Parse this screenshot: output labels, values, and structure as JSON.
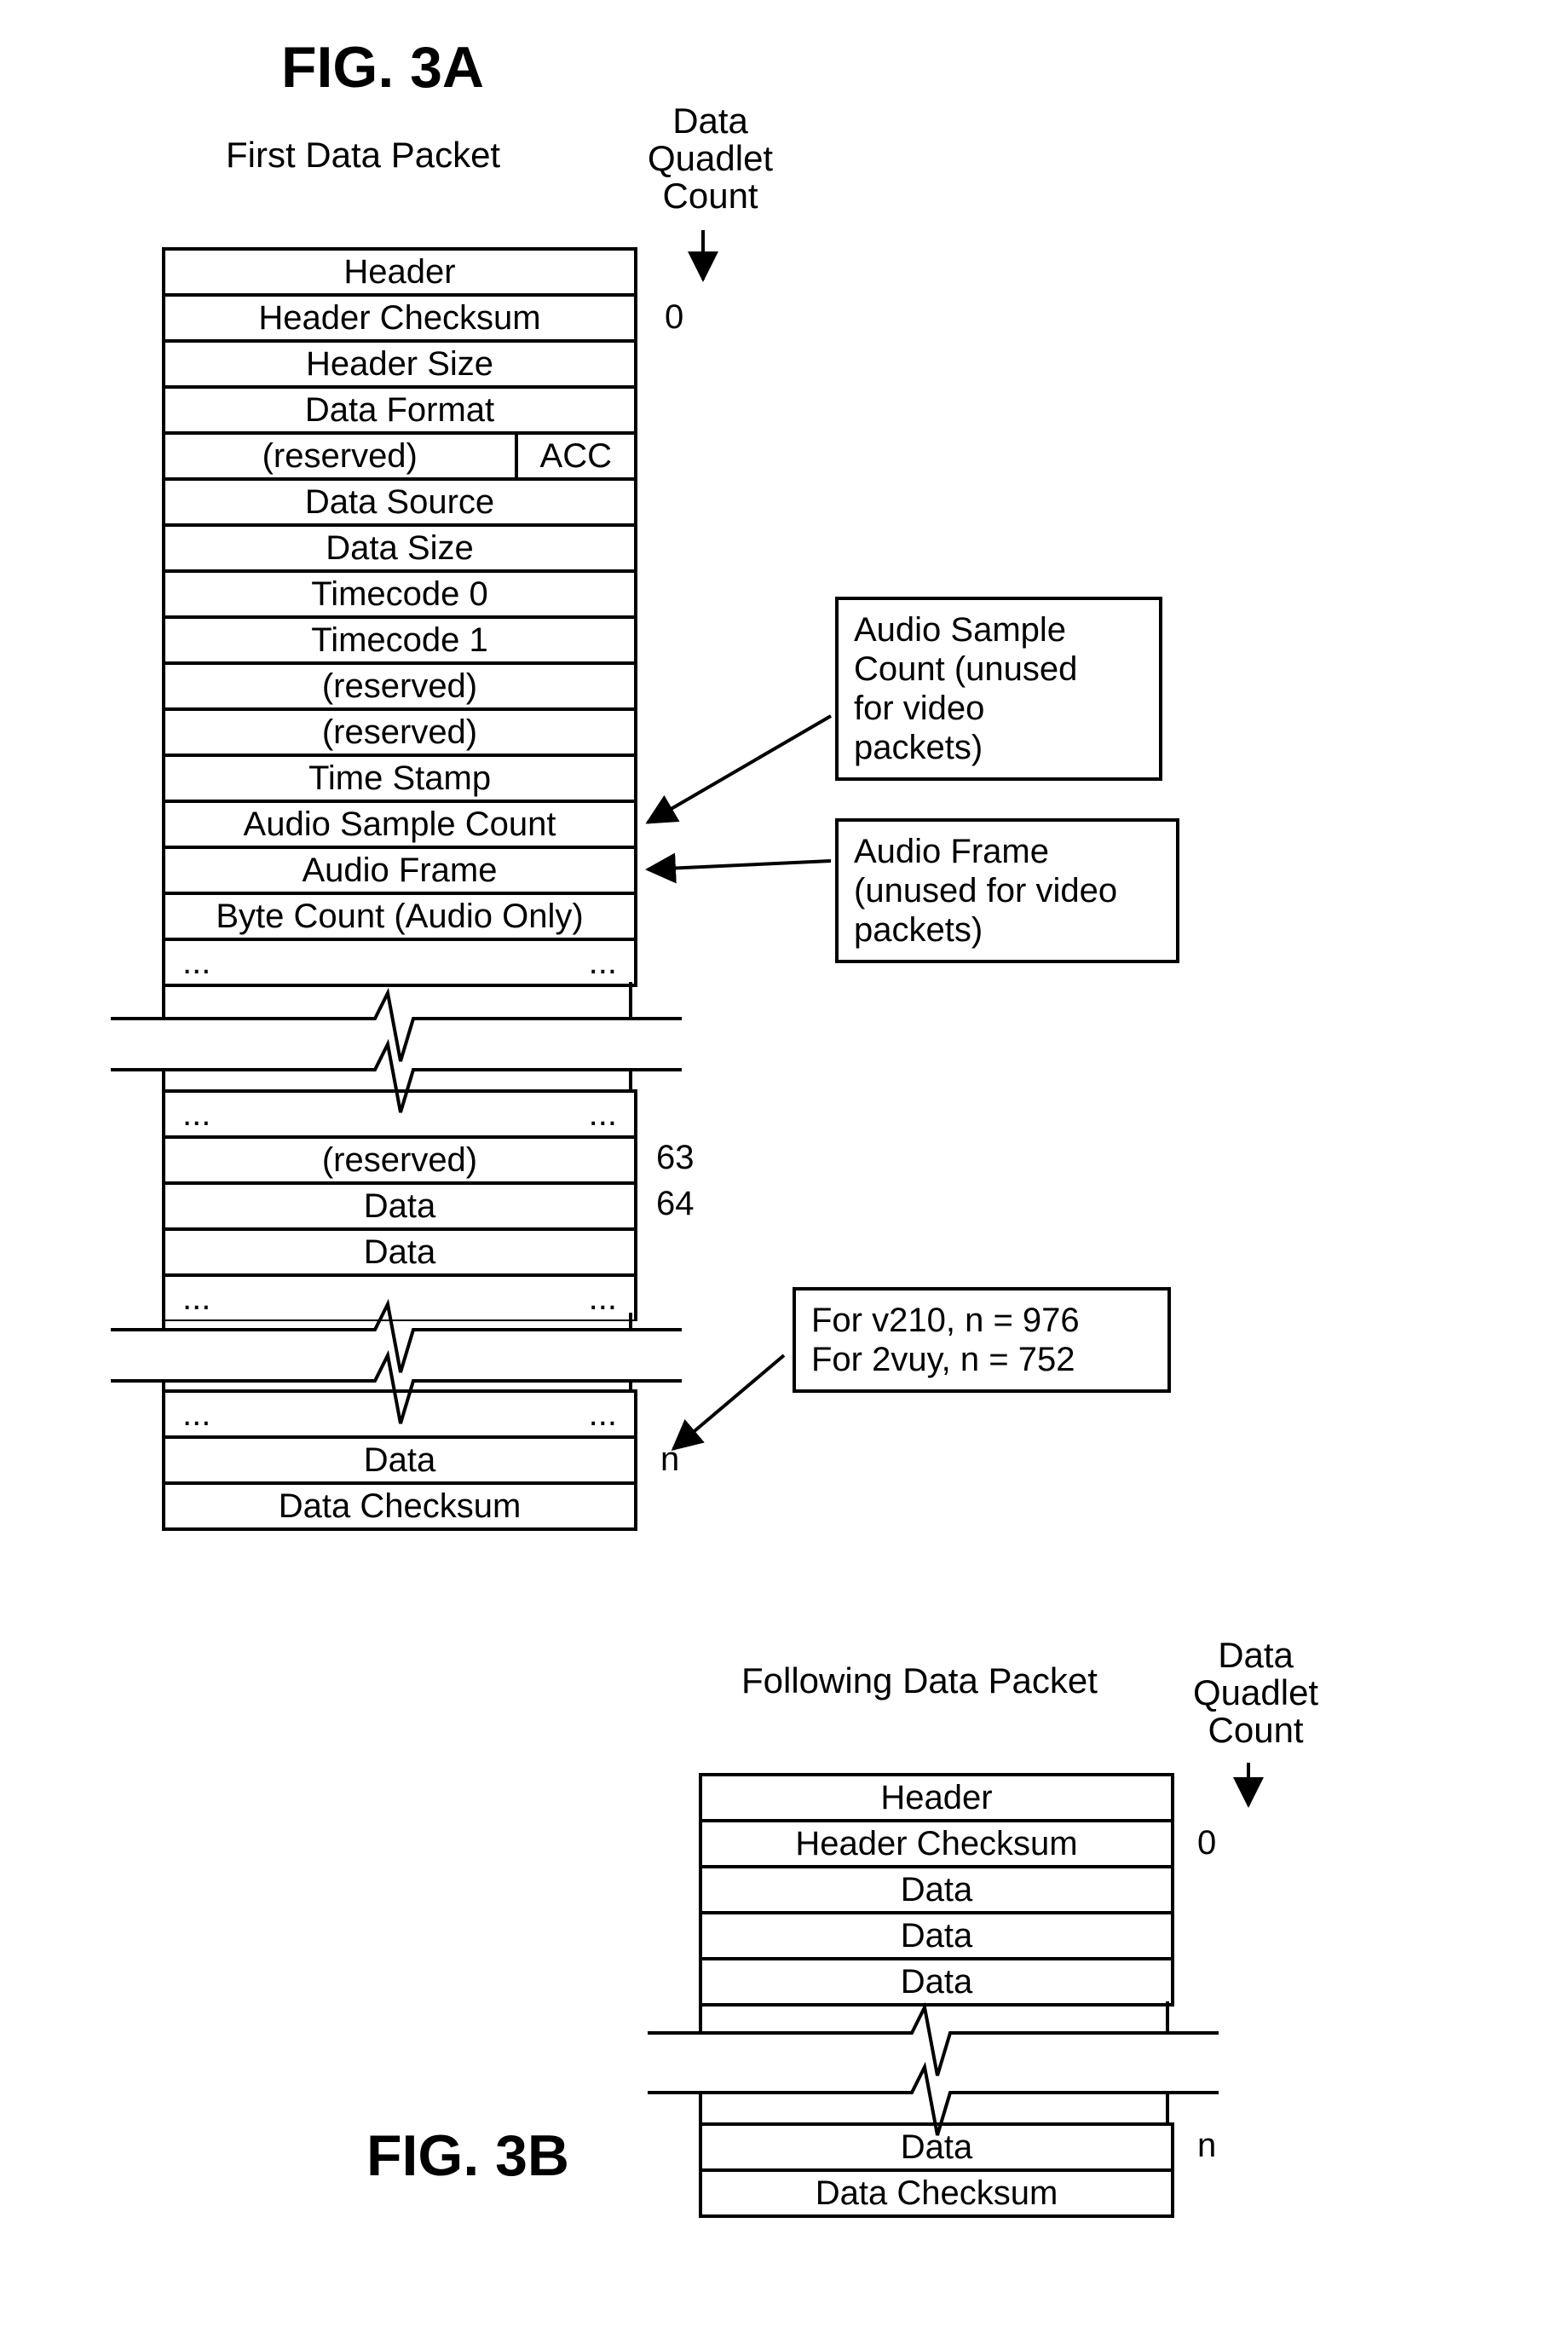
{
  "fig3a": {
    "title": "FIG. 3A",
    "packet_title": "First Data Packet",
    "quadlet_heading": "Data\nQuadlet\nCount",
    "rows_top": [
      "Header",
      "Header Checksum",
      "Header Size",
      "Data Format"
    ],
    "row_split": {
      "left": "(reserved)",
      "right": "ACC"
    },
    "rows_after_split": [
      "Data Source",
      "Data Size",
      "Timecode 0",
      "Timecode 1",
      "(reserved)",
      "(reserved)",
      "Time Stamp",
      "Audio Sample Count",
      "Audio Frame",
      "Byte Count (Audio Only)"
    ],
    "ellipsis": "...",
    "counts": {
      "zero": "0",
      "sixtythree": "63",
      "sixtyfour": "64",
      "n": "n"
    },
    "mid_rows": [
      "(reserved)",
      "Data",
      "Data"
    ],
    "bottom_rows": [
      "Data",
      "Data Checksum"
    ],
    "callout_asc": "Audio Sample\nCount (unused\nfor video\npackets)",
    "callout_af": "Audio Frame\n(unused for video\npackets)",
    "callout_n": "For v210, n = 976\nFor 2vuy, n = 752"
  },
  "fig3b": {
    "title": "FIG. 3B",
    "packet_title": "Following Data Packet",
    "quadlet_heading": "Data\nQuadlet\nCount",
    "rows_top": [
      "Header",
      "Header Checksum",
      "Data",
      "Data",
      "Data"
    ],
    "counts": {
      "zero": "0",
      "n": "n"
    },
    "rows_bottom": [
      "Data",
      "Data Checksum"
    ]
  }
}
